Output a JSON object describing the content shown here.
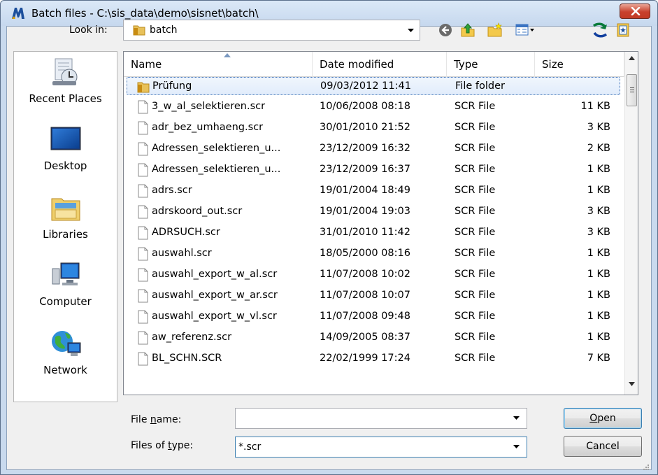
{
  "window": {
    "title": "Batch files - C:\\sis_data\\demo\\sisnet\\batch\\"
  },
  "toolbar": {
    "look_in_label": "Look in:",
    "look_in_value": "batch",
    "icons": [
      "back-icon",
      "up-folder-icon",
      "new-folder-icon",
      "view-menu-icon",
      "refresh-icon",
      "favorites-icon"
    ]
  },
  "places": [
    {
      "label": "Recent Places",
      "icon": "recent-places-icon"
    },
    {
      "label": "Desktop",
      "icon": "desktop-icon"
    },
    {
      "label": "Libraries",
      "icon": "libraries-icon"
    },
    {
      "label": "Computer",
      "icon": "computer-icon"
    },
    {
      "label": "Network",
      "icon": "network-icon"
    }
  ],
  "columns": {
    "name": "Name",
    "date": "Date modified",
    "type": "Type",
    "size": "Size"
  },
  "files": [
    {
      "name": "Prüfung",
      "date": "09/03/2012 11:41",
      "type": "File folder",
      "size": "",
      "kind": "folder",
      "selected": true
    },
    {
      "name": "3_w_al_selektieren.scr",
      "date": "10/06/2008 08:18",
      "type": "SCR File",
      "size": "11 KB",
      "kind": "file"
    },
    {
      "name": "adr_bez_umhaeng.scr",
      "date": "30/01/2010 21:52",
      "type": "SCR File",
      "size": "3 KB",
      "kind": "file"
    },
    {
      "name": "Adressen_selektieren_u...",
      "date": "23/12/2009 16:32",
      "type": "SCR File",
      "size": "2 KB",
      "kind": "file"
    },
    {
      "name": "Adressen_selektieren_u...",
      "date": "23/12/2009 16:37",
      "type": "SCR File",
      "size": "1 KB",
      "kind": "file"
    },
    {
      "name": "adrs.scr",
      "date": "19/01/2004 18:49",
      "type": "SCR File",
      "size": "1 KB",
      "kind": "file"
    },
    {
      "name": "adrskoord_out.scr",
      "date": "19/01/2004 19:03",
      "type": "SCR File",
      "size": "3 KB",
      "kind": "file"
    },
    {
      "name": "ADRSUCH.scr",
      "date": "31/01/2010 11:42",
      "type": "SCR File",
      "size": "3 KB",
      "kind": "file"
    },
    {
      "name": "auswahl.scr",
      "date": "18/05/2000 08:16",
      "type": "SCR File",
      "size": "1 KB",
      "kind": "file"
    },
    {
      "name": "auswahl_export_w_al.scr",
      "date": "11/07/2008 10:02",
      "type": "SCR File",
      "size": "1 KB",
      "kind": "file"
    },
    {
      "name": "auswahl_export_w_ar.scr",
      "date": "11/07/2008 10:07",
      "type": "SCR File",
      "size": "1 KB",
      "kind": "file"
    },
    {
      "name": "auswahl_export_w_vl.scr",
      "date": "11/07/2008 09:48",
      "type": "SCR File",
      "size": "1 KB",
      "kind": "file"
    },
    {
      "name": "aw_referenz.scr",
      "date": "14/09/2005 08:37",
      "type": "SCR File",
      "size": "1 KB",
      "kind": "file"
    },
    {
      "name": "BL_SCHN.SCR",
      "date": "22/02/1999 17:24",
      "type": "SCR File",
      "size": "7 KB",
      "kind": "file"
    }
  ],
  "bottom": {
    "file_name_label_pre": "File ",
    "file_name_label_ul": "n",
    "file_name_label_post": "ame:",
    "file_name_value": "",
    "files_of_type_label_pre": "Files of ",
    "files_of_type_label_ul": "t",
    "files_of_type_label_post": "ype:",
    "files_of_type_value": "*.scr",
    "open_ul": "O",
    "open_rest": "pen",
    "cancel_label": "Cancel"
  }
}
